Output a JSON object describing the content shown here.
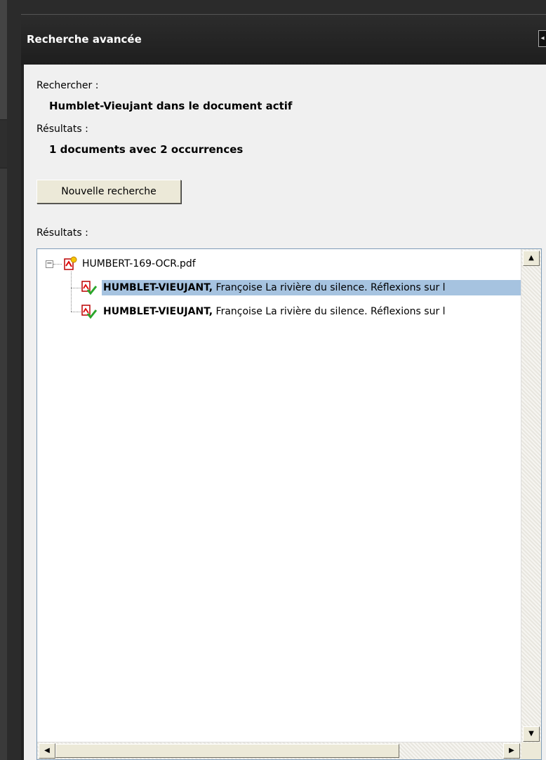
{
  "panel": {
    "title": "Recherche avancée"
  },
  "search": {
    "query_label": "Rechercher :",
    "query_value": "Humblet-Vieujant dans le document actif",
    "summary_label": "Résultats :",
    "summary_value": "1 documents avec 2 occurrences",
    "new_search_button": "Nouvelle recherche",
    "results_label": "Résultats :"
  },
  "results": {
    "document": "HUMBERT-169-OCR.pdf",
    "items": [
      {
        "match": "HUMBLET-VIEUJANT,",
        "context": " Françoise La rivière du silence. Réflexions sur l"
      },
      {
        "match": "HUMBLET-VIEUJANT,",
        "context": " Françoise La rivière du silence. Réflexions sur l"
      }
    ]
  },
  "colors": {
    "selection": "#a6c3e0",
    "panel_bg": "#f0f0f0",
    "titlebar": "#222222"
  }
}
